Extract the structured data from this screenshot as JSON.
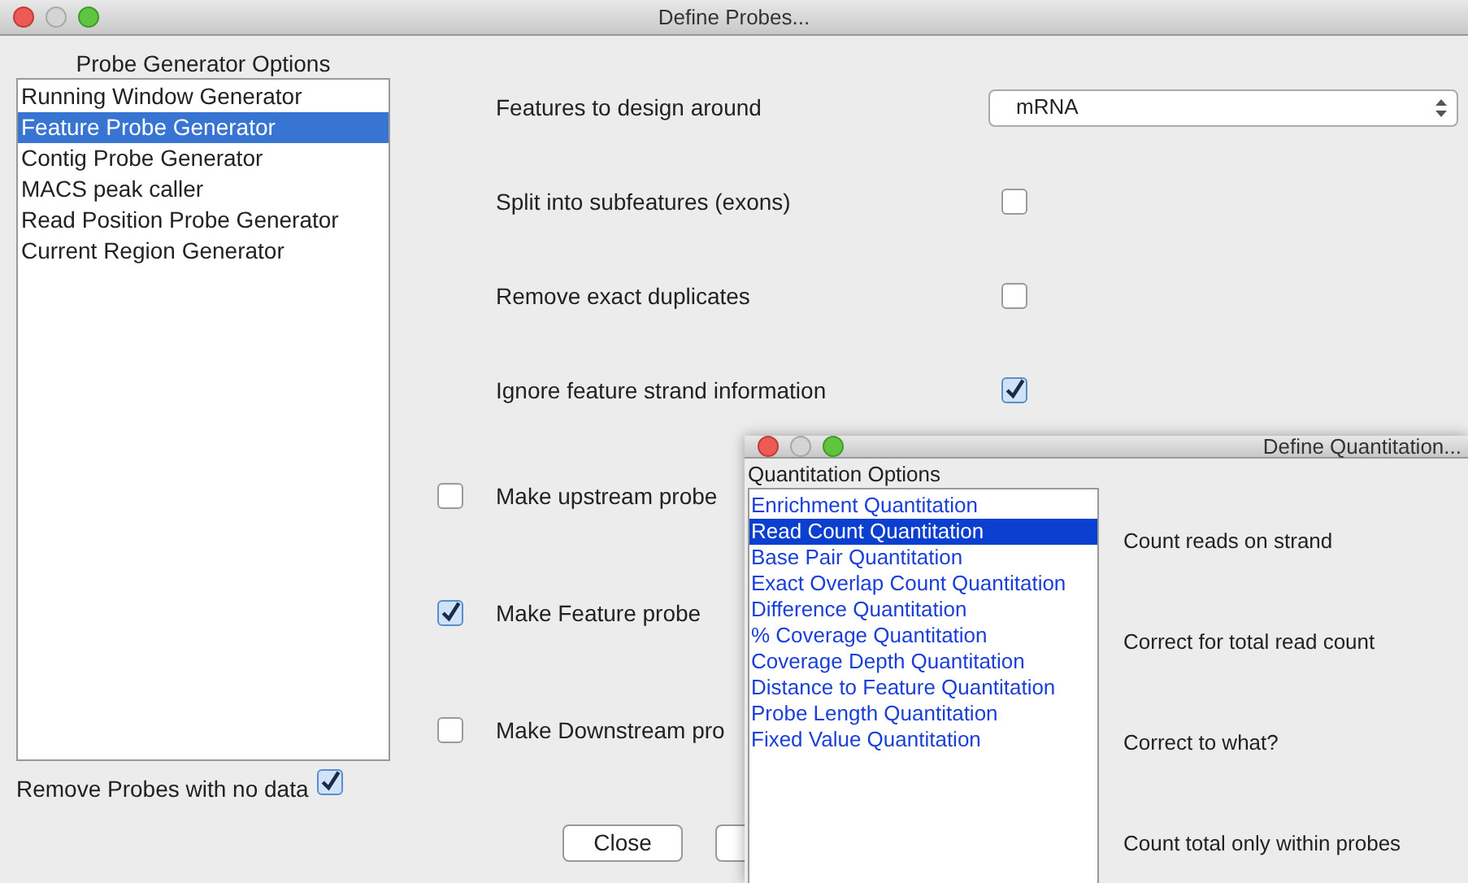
{
  "main_window": {
    "title": "Define Probes...",
    "generator_list": {
      "header": "Probe Generator Options",
      "items": [
        {
          "label": "Running Window Generator",
          "selected": false
        },
        {
          "label": "Feature Probe Generator",
          "selected": true
        },
        {
          "label": "Contig Probe Generator",
          "selected": false
        },
        {
          "label": "MACS peak caller",
          "selected": false
        },
        {
          "label": "Read Position Probe Generator",
          "selected": false
        },
        {
          "label": "Current Region Generator",
          "selected": false
        }
      ]
    },
    "remove_no_data": {
      "label": "Remove Probes with no data",
      "checked": true
    },
    "options": [
      {
        "kind": "select",
        "label": "Features to design around",
        "value": "mRNA"
      },
      {
        "kind": "checkbox",
        "label": "Split into subfeatures (exons)",
        "checked": false
      },
      {
        "kind": "checkbox",
        "label": "Remove exact duplicates",
        "checked": false
      },
      {
        "kind": "checkbox",
        "label": "Ignore feature strand information",
        "checked": true
      }
    ],
    "probe_options": [
      {
        "label": "Make upstream probe",
        "checked": false
      },
      {
        "label": "Make Feature probe",
        "checked": true
      },
      {
        "label": "Make Downstream pro",
        "checked": false
      }
    ],
    "buttons": [
      "Close"
    ]
  },
  "quantitation_window": {
    "title": "Define Quantitation...",
    "options_list": {
      "header": "Quantitation Options",
      "items": [
        {
          "label": "Enrichment Quantitation",
          "selected": false
        },
        {
          "label": "Read Count Quantitation",
          "selected": true
        },
        {
          "label": "Base Pair Quantitation",
          "selected": false
        },
        {
          "label": "Exact Overlap Count Quantitation",
          "selected": false
        },
        {
          "label": "Difference Quantitation",
          "selected": false
        },
        {
          "label": "% Coverage Quantitation",
          "selected": false
        },
        {
          "label": "Coverage Depth Quantitation",
          "selected": false
        },
        {
          "label": "Distance to Feature Quantitation",
          "selected": false
        },
        {
          "label": "Probe Length Quantitation",
          "selected": false
        },
        {
          "label": "Fixed Value Quantitation",
          "selected": false
        }
      ]
    },
    "settings": [
      "Count reads on strand",
      "Correct for total read count",
      "Correct to what?",
      "Count total only within probes"
    ]
  }
}
